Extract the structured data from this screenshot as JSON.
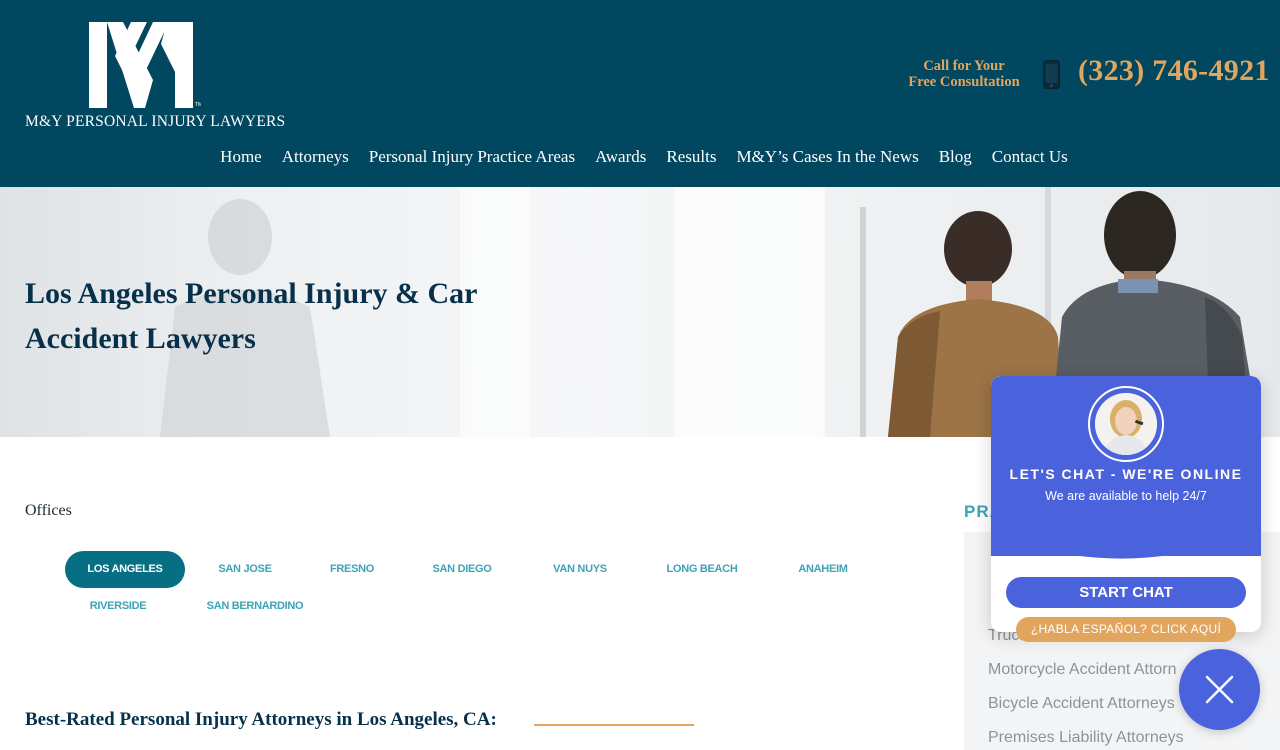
{
  "brand": {
    "name": "M&Y PERSONAL INJURY LAWYERS",
    "colors": {
      "header_bg": "#01475f",
      "accent_gold": "#e2a55e",
      "teal": "#066f83",
      "chat_blue": "#4a63dd"
    }
  },
  "header": {
    "call_label_line1": "Call for Your",
    "call_label_line2": "Free Consultation",
    "phone_number": "(323) 746-4921",
    "nav": [
      {
        "label": "Home"
      },
      {
        "label": "Attorneys"
      },
      {
        "label": "Personal Injury Practice Areas"
      },
      {
        "label": "Awards"
      },
      {
        "label": "Results"
      },
      {
        "label": "M&Y’s Cases In the News"
      },
      {
        "label": "Blog"
      },
      {
        "label": "Contact Us"
      }
    ]
  },
  "hero": {
    "title": "Los Angeles Personal Injury & Car Accident Lawyers"
  },
  "offices": {
    "label": "Offices",
    "items": [
      "LOS ANGELES",
      "SAN JOSE",
      "FRESNO",
      "SAN DIEGO",
      "VAN NUYS",
      "LONG BEACH",
      "ANAHEIM",
      "RIVERSIDE",
      "SAN BERNARDINO"
    ],
    "active": "LOS ANGELES"
  },
  "main": {
    "section_title": "Best-Rated Personal Injury Attorneys in Los Angeles, CA:"
  },
  "sidebar": {
    "heading": "PRA",
    "items": [
      "Truck",
      "Motorcycle Accident Attorn",
      "Bicycle Accident Attorneys",
      "Premises Liability Attorneys"
    ]
  },
  "chat": {
    "title": "LET'S CHAT - WE'RE ONLINE",
    "subtitle": "We are available to help 24/7",
    "start_label": "START CHAT",
    "espanol_label": "¿HABLA ESPAÑOL? CLICK AQUÍ"
  }
}
